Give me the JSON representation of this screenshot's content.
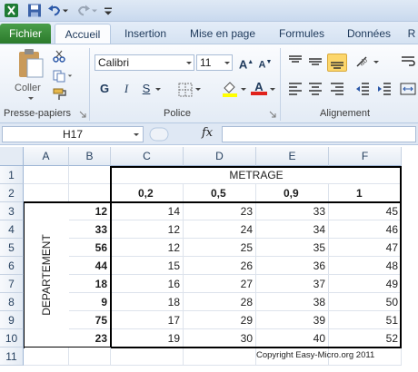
{
  "qat": {
    "icons": [
      "excel-logo-icon",
      "save-icon",
      "undo-icon",
      "redo-icon",
      "customize-icon"
    ]
  },
  "tabs": [
    "Fichier",
    "Accueil",
    "Insertion",
    "Mise en page",
    "Formules",
    "Données",
    "R"
  ],
  "ribbon": {
    "paste_label": "Coller",
    "font_name": "Calibri",
    "font_size": "11",
    "bold": "G",
    "italic": "I",
    "underline": "S",
    "grow_font": "A",
    "shrink_font": "A",
    "font_color_letter": "A",
    "groups": [
      "Presse-papiers",
      "Police",
      "Alignement"
    ]
  },
  "formula_bar": {
    "name_box": "H17",
    "fx": "fx",
    "formula": ""
  },
  "grid": {
    "columns": [
      "A",
      "B",
      "C",
      "D",
      "E",
      "F"
    ],
    "rows": [
      "1",
      "2",
      "3",
      "4",
      "5",
      "6",
      "7",
      "8",
      "9",
      "10",
      "11"
    ],
    "title": "METRAGE",
    "metrage_headers": [
      "0,2",
      "0,5",
      "0,9",
      "1"
    ],
    "department_label": "DEPARTEMENT",
    "departments": [
      "12",
      "33",
      "56",
      "44",
      "18",
      "9",
      "75",
      "23"
    ],
    "values": [
      [
        "14",
        "23",
        "33",
        "45"
      ],
      [
        "12",
        "24",
        "34",
        "46"
      ],
      [
        "12",
        "25",
        "35",
        "47"
      ],
      [
        "15",
        "26",
        "36",
        "48"
      ],
      [
        "16",
        "27",
        "37",
        "49"
      ],
      [
        "18",
        "28",
        "38",
        "50"
      ],
      [
        "17",
        "29",
        "39",
        "51"
      ],
      [
        "19",
        "30",
        "40",
        "52"
      ]
    ],
    "copyright": "Copyright Easy-Micro.org 2011"
  }
}
